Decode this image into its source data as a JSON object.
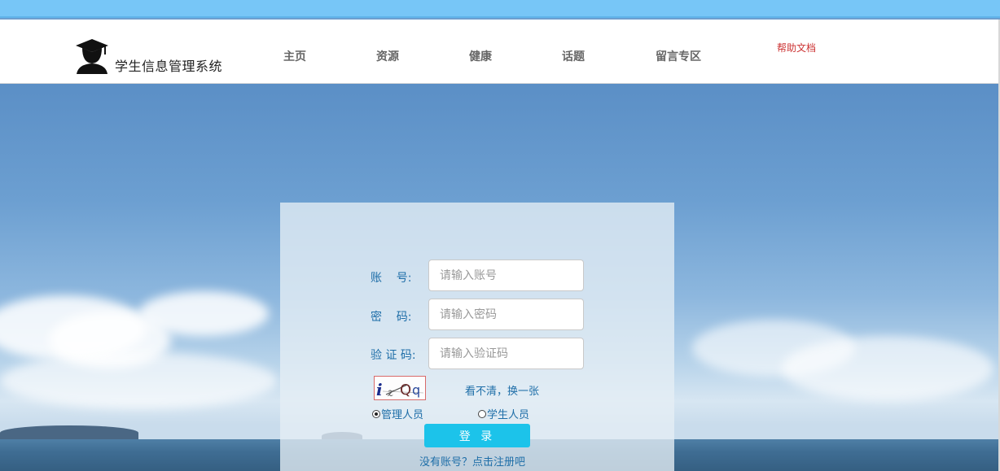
{
  "header": {
    "site_title": "学生信息管理系统",
    "nav": [
      {
        "label": "主页"
      },
      {
        "label": "资源"
      },
      {
        "label": "健康"
      },
      {
        "label": "话题"
      },
      {
        "label": "留言专区"
      }
    ],
    "help_label": "帮助文档"
  },
  "login": {
    "account_label": "账    号:",
    "account_placeholder": "请输入账号",
    "password_label": "密    码:",
    "password_placeholder": "请输入密码",
    "captcha_label": "验 证 码:",
    "captcha_placeholder": "请输入验证码",
    "captcha_text": "i 𝓏Qq",
    "captcha_refresh": "看不清，换一张",
    "roles": [
      {
        "label": "管理人员",
        "checked": true
      },
      {
        "label": "学生人员",
        "checked": false
      }
    ],
    "submit_label": "登 录",
    "register_label": "没有账号？点击注册吧"
  },
  "colors": {
    "topbar": "#77c6f7",
    "accent_button": "#1cc3ea",
    "label_text": "#1e6ea8",
    "help_link": "#cc3333"
  },
  "icons": {
    "logo": "graduate-student-icon"
  }
}
